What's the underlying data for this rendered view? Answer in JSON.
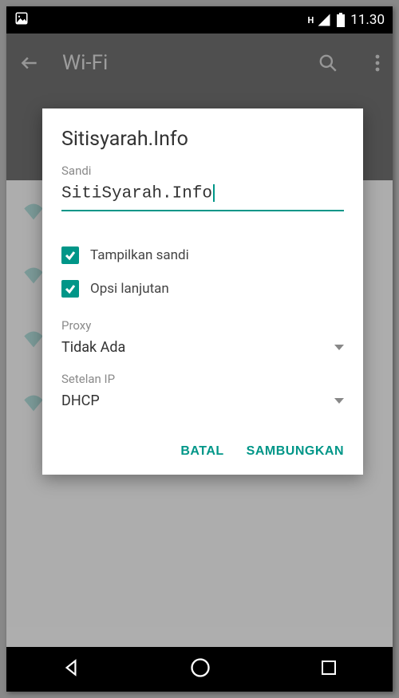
{
  "status": {
    "time": "11.30",
    "net_label": "H"
  },
  "appbar": {
    "title": "Wi-Fi"
  },
  "dialog": {
    "title": "Sitisyarah.Info",
    "password_label": "Sandi",
    "password_value": "SitiSyarah.Info",
    "show_password_label": "Tampilkan sandi",
    "advanced_label": "Opsi lanjutan",
    "proxy_label": "Proxy",
    "proxy_value": "Tidak Ada",
    "ip_label": "Setelan IP",
    "ip_value": "DHCP",
    "cancel": "BATAL",
    "connect": "SAMBUNGKAN"
  }
}
